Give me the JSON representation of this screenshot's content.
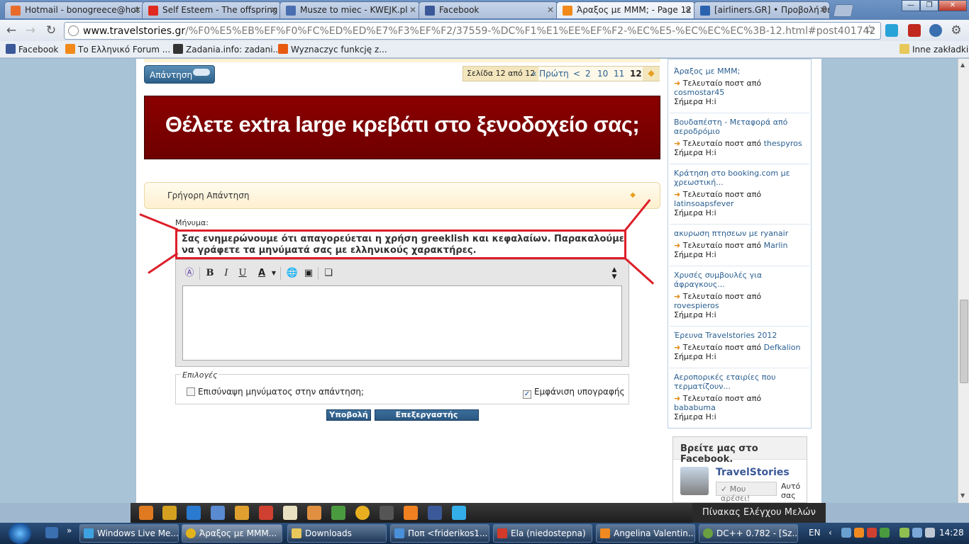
{
  "browser": {
    "tabs": [
      {
        "label": "Hotmail - bonogreece@hot",
        "color": "#e86b2a"
      },
      {
        "label": "Self Esteem - The offspring",
        "color": "#e02a20"
      },
      {
        "label": "Musze to miec - KWEJK.pl",
        "color": "#4a6fb0"
      },
      {
        "label": "Facebook",
        "color": "#3b5998"
      },
      {
        "label": "Άραξος με MMM; - Page 12",
        "color": "#f18a1a"
      },
      {
        "label": "[airliners.GR] • Προβολή θέ",
        "color": "#2a62b0"
      }
    ],
    "window_controls": [
      "—",
      "❐",
      "✕"
    ],
    "url_host": "www.travelstories.gr",
    "url_path": "/%F0%E5%EB%EF%F0%FC%ED%ED%E7%F3%EF%F2/37559-%DC%F1%E1%EE%EF%F2-%EC%E5-%EC%EC%EC%3B-12.html#post401742",
    "bookmarks": [
      {
        "label": "Facebook",
        "color": "#3b5998"
      },
      {
        "label": "Το Ελληνικό Forum ...",
        "color": "#f18a1a"
      },
      {
        "label": "Zadania.info: zadani...",
        "color": "#333333"
      },
      {
        "label": "Wyznaczyc funkcję z...",
        "color": "#e85a10"
      }
    ],
    "other_bookmarks": "Inne zakładki"
  },
  "page": {
    "reply_button": "Απάντηση",
    "pager": {
      "label": "Σελίδα 12 από 12",
      "first": "« Πρώτη",
      "prev": "<",
      "pages": [
        "2",
        "10",
        "11",
        "12"
      ]
    },
    "banner": "Θέλετε extra large κρεβάτι στο ξενοδοχείο σας;",
    "quick_reply": "Γρήγορη Απάντηση",
    "message_label": "Μήνυμα:",
    "warning": "Σας ενημερώνουμε ότι απαγορεύεται η χρήση greeklish και κεφαλαίων. Παρακαλούμε να γράφετε τα μηνύματά σας με ελληνικούς χαρακτήρες.",
    "editor_buttons": {
      "bold": "B",
      "italic": "I",
      "underline": "U",
      "color": "A"
    },
    "options_legend": "Επιλογές",
    "option_quote": "Επισύναψη μηνύματος στην απάντηση;",
    "option_signature": "Εμφάνιση υπογραφής",
    "signature_checked": true,
    "submit": "Υποβολή",
    "edit_text": "Επεξεργαστής Κειμένου",
    "annotation_color": "#dd1f2a"
  },
  "sidebar": {
    "prefix": "Τελευταίο ποστ από",
    "day": "Σήμερα Η:i",
    "threads": [
      {
        "title": "Άραξος με MMM;",
        "user": "cosmostar45"
      },
      {
        "title": "Βουδαπέστη - Μεταφορά από αεροδρόμιο",
        "user": "thespyros"
      },
      {
        "title": "Κράτηση στο booking.com με χρεωστική...",
        "user": "latinsoapsfever"
      },
      {
        "title": "ακυρωση πτησεων με ryanair",
        "user": "Marlin"
      },
      {
        "title": "Χρυσές συμβουλές για άφραγκους...",
        "user": "rovespieros"
      },
      {
        "title": "Έρευνα Travelstories 2012",
        "user": "Defkalion"
      },
      {
        "title": "Αεροπορικές εταιρίες που τερματίζουν...",
        "user": "bababuma"
      }
    ],
    "facebook": {
      "heading": "Βρείτε μας στο Facebook.",
      "name": "TravelStories",
      "like": "✓ Μου αρέσει!",
      "side_text": "Αυτό σας"
    }
  },
  "site_toolbar": {
    "panel": "Πίνακας Ελέγχου Μελών"
  },
  "taskbar": {
    "items": [
      {
        "label": "Windows Live Me...",
        "color": "#3fa2e0"
      },
      {
        "label": "Άραξος με MMM...",
        "color": "#e3b31c"
      },
      {
        "label": "Downloads",
        "color": "#e8c85a"
      },
      {
        "label": "Ποπ <friderikos1...",
        "color": "#4a90d9"
      },
      {
        "label": "Ela (niedostepna)",
        "color": "#d33a2a"
      },
      {
        "label": "Angelina Valentin...",
        "color": "#f08a20"
      },
      {
        "label": "DC++ 0.782 - [Sz...",
        "color": "#6aa040"
      }
    ],
    "lang": "EN",
    "clock": "14:28"
  }
}
